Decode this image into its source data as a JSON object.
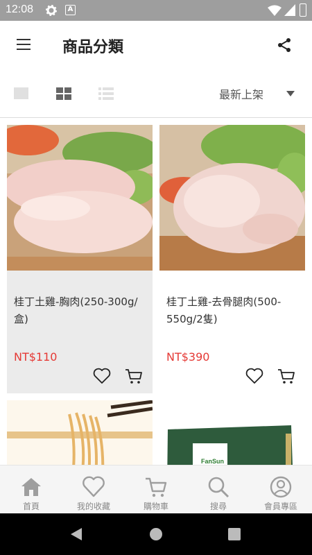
{
  "status": {
    "time": "12:08",
    "icons": [
      "gear-icon",
      "a-icon",
      "wifi-icon",
      "signal-icon",
      "battery-icon"
    ]
  },
  "appbar": {
    "title": "商品分類",
    "menu_icon": "hamburger-icon",
    "share_icon": "share-icon"
  },
  "toolbar": {
    "views": [
      "single-view-icon",
      "grid-view-icon",
      "list-view-icon"
    ],
    "active_view": "grid",
    "sort_label": "最新上架"
  },
  "products": [
    {
      "name": "桂丁土雞-胸肉(250-300g/盒)",
      "price": "NT$110"
    },
    {
      "name": "桂丁土雞-去骨腿肉(500-550g/2隻)",
      "price": "NT$390"
    },
    {
      "name": "",
      "price": ""
    },
    {
      "name": "",
      "price": ""
    }
  ],
  "product_box_label": "FanSun",
  "bottom_nav": [
    {
      "label": "首頁",
      "icon": "home-icon"
    },
    {
      "label": "我的收藏",
      "icon": "heart-icon"
    },
    {
      "label": "購物車",
      "icon": "cart-icon"
    },
    {
      "label": "搜尋",
      "icon": "search-icon"
    },
    {
      "label": "會員專區",
      "icon": "member-icon"
    }
  ],
  "colors": {
    "price": "#e53935",
    "statusbar": "#9e9e9e",
    "nav_icon": "#9e9e9e"
  }
}
